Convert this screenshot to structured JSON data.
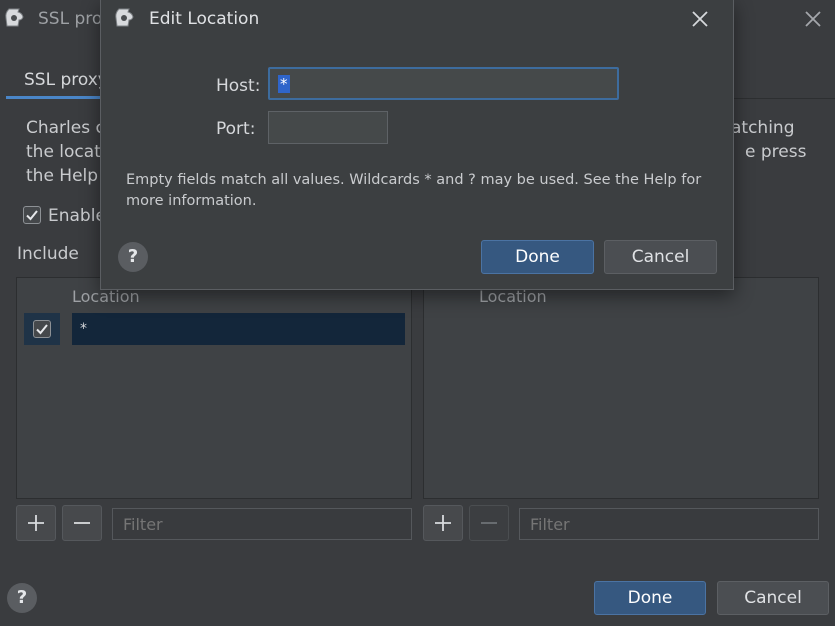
{
  "background_window": {
    "title": "SSL prox",
    "tab_label": "SSL proxy",
    "description_lines_left": [
      "Charles ca",
      "the locatio",
      "the Help"
    ],
    "description_lines_right": [
      "atching",
      "e press"
    ],
    "enable_label": "Enable",
    "include_label": "Include",
    "include_table": {
      "column_header": "Location",
      "rows": [
        {
          "checked": true,
          "location": "*"
        }
      ]
    },
    "exclude_table": {
      "column_header": "Location",
      "rows": []
    },
    "include_filter_placeholder": "Filter",
    "exclude_filter_placeholder": "Filter",
    "add_glyph": "+",
    "remove_glyph": "−",
    "done_label": "Done",
    "cancel_label": "Cancel",
    "help_glyph": "?"
  },
  "dialog": {
    "title": "Edit Location",
    "host_label": "Host:",
    "host_value": "*",
    "port_label": "Port:",
    "port_value": "",
    "note": "Empty fields match all values. Wildcards * and ? may be used. See the Help for more information.",
    "done_label": "Done",
    "cancel_label": "Cancel",
    "help_glyph": "?"
  },
  "colors": {
    "accent": "#365880",
    "selection": "#13263a",
    "background": "#3a3c3f"
  }
}
